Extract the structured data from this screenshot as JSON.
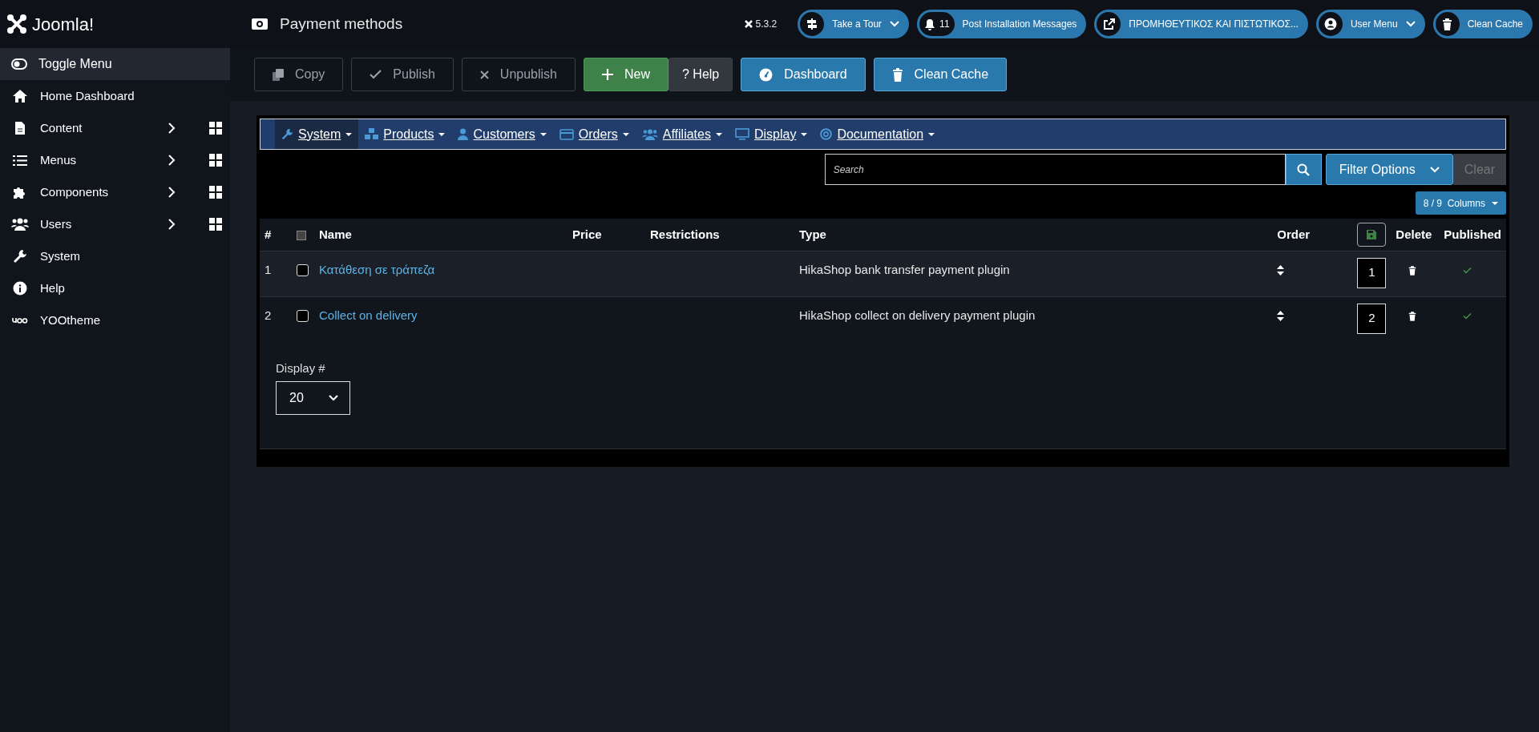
{
  "header": {
    "brand": "Joomla!",
    "title": "Payment methods",
    "version": "5.3.2",
    "buttons": [
      {
        "label": "Take a Tour",
        "kind": "dropdown"
      },
      {
        "label": "Post Installation Messages",
        "count": "11",
        "kind": "count"
      },
      {
        "label": "ΠΡΟΜΗΘΕΥΤΙΚΟΣ ΚΑΙ ΠΙΣΤΩΤΙΚΟΣ...",
        "kind": "plain"
      },
      {
        "label": "User Menu",
        "kind": "dropdown"
      },
      {
        "label": "Clean Cache",
        "kind": "plain"
      }
    ]
  },
  "sidebar": {
    "toggle": "Toggle Menu",
    "items": [
      {
        "label": "Home Dashboard",
        "has_submenu": false
      },
      {
        "label": "Content",
        "has_submenu": true
      },
      {
        "label": "Menus",
        "has_submenu": true
      },
      {
        "label": "Components",
        "has_submenu": true
      },
      {
        "label": "Users",
        "has_submenu": true
      },
      {
        "label": "System",
        "has_submenu": false
      },
      {
        "label": "Help",
        "has_submenu": false
      },
      {
        "label": "YOOtheme",
        "has_submenu": false
      }
    ]
  },
  "toolbar": {
    "buttons": [
      {
        "label": "Copy",
        "kind": "outline",
        "disabled": true
      },
      {
        "label": "Publish",
        "kind": "outline",
        "disabled": true
      },
      {
        "label": "Unpublish",
        "kind": "outline",
        "disabled": true
      },
      {
        "label": "New",
        "kind": "success",
        "disabled": false
      },
      {
        "label": "? Help",
        "kind": "dark",
        "disabled": false
      },
      {
        "label": "Dashboard",
        "kind": "info",
        "disabled": false
      },
      {
        "label": "Clean Cache",
        "kind": "info",
        "disabled": false
      }
    ]
  },
  "shop_menu": {
    "items": [
      {
        "label": "System",
        "selected": true
      },
      {
        "label": "Products",
        "selected": false
      },
      {
        "label": "Customers",
        "selected": false
      },
      {
        "label": "Orders",
        "selected": false
      },
      {
        "label": "Affiliates",
        "selected": false
      },
      {
        "label": "Display",
        "selected": false
      },
      {
        "label": "Documentation",
        "selected": false
      }
    ]
  },
  "filters": {
    "search": {
      "placeholder": "Search"
    },
    "filter_button": "Filter Options",
    "clear_button": {
      "label": "Clear",
      "disabled": true
    },
    "columns_button": "8 / 9  Columns"
  },
  "table": {
    "columns": [
      {
        "kind": "text",
        "label": "#"
      },
      {
        "kind": "checkbox",
        "checked": false
      },
      {
        "kind": "text",
        "label": "Name"
      },
      {
        "kind": "text",
        "label": "Price"
      },
      {
        "kind": "text",
        "label": "Restrictions"
      },
      {
        "kind": "text",
        "label": "Type"
      },
      {
        "kind": "text",
        "label": "Order"
      },
      {
        "kind": "save"
      },
      {
        "kind": "text",
        "label": "Delete"
      },
      {
        "kind": "text",
        "label": "Published"
      }
    ],
    "rows": [
      {
        "number": "1",
        "checked": false,
        "name": "Κατάθεση σε τράπεζα",
        "type": "HikaShop bank transfer payment plugin",
        "ordering": "1",
        "published": true
      },
      {
        "number": "2",
        "checked": false,
        "name": "Collect on delivery",
        "type": "HikaShop collect on delivery payment plugin",
        "ordering": "2",
        "published": true
      }
    ]
  },
  "pagination": {
    "label": "Display #",
    "value": "20"
  }
}
